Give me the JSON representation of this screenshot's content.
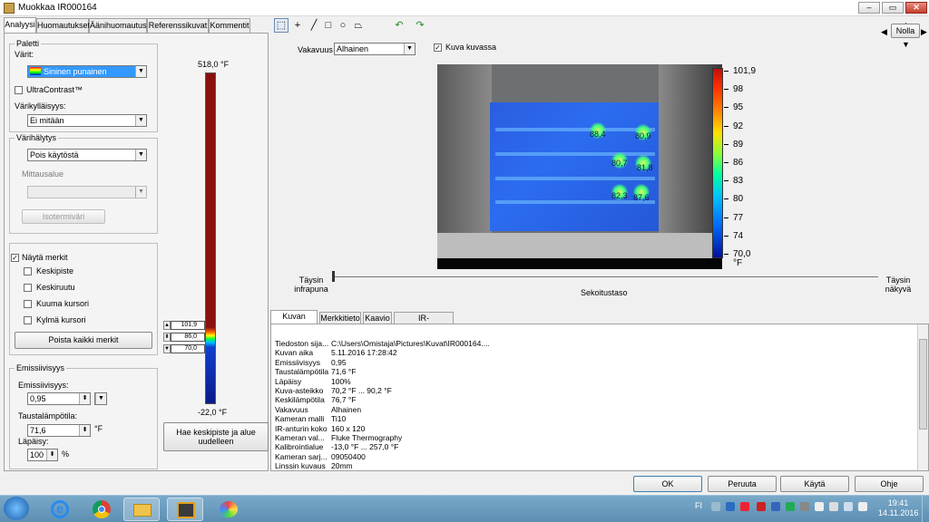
{
  "window": {
    "title": "Muokkaa IR000164",
    "min": "–",
    "max": "▭",
    "close": "✕"
  },
  "tabs": [
    "Analyysi",
    "Huomautukset",
    "Äänihuomautus",
    "Referenssikuvat",
    "Kommentit"
  ],
  "palette": {
    "group": "Paletti",
    "colors_label": "Värit:",
    "colors_value": "Sininen punainen",
    "ultracontrast": "UltraContrast™",
    "saturation_label": "Värikylläisyys:",
    "saturation_value": "Ei mitään"
  },
  "alarm": {
    "group": "Värihälytys",
    "value": "Pois käytöstä",
    "range_label": "Mittausalue",
    "isotherm": "Isotermiväri"
  },
  "markers": {
    "show": "Näytä merkit",
    "items": [
      "Keskipiste",
      "Keskiruutu",
      "Kuuma kursori",
      "Kylmä kursori"
    ],
    "remove_all": "Poista kaikki merkit"
  },
  "emissivity": {
    "group": "Emissiivisyys",
    "label": "Emissiivisyys:",
    "value": "0,95",
    "bg_label": "Taustalämpötila:",
    "bg_value": "71,6",
    "bg_unit": "°F",
    "trans_label": "Läpäisy:",
    "trans_value": "100",
    "trans_unit": "%"
  },
  "scale": {
    "top": "518,0 °F",
    "bottom": "-22,0 °F",
    "markers": [
      "101,9",
      "86,0",
      "70,0"
    ]
  },
  "reset_button": "Hae keskipiste ja alue uudelleen",
  "toolbar": {
    "icons": [
      "marquee-icon",
      "crosshair-icon",
      "line-icon",
      "square-icon",
      "circle-icon",
      "polygon-icon"
    ],
    "vakavuus_label": "Vakavuus",
    "vakavuus_value": "Alhainen",
    "kuva_kuvassa": "Kuva kuvassa",
    "nolla": "Nolla"
  },
  "image": {
    "scale_labels": [
      "101,9",
      "98",
      "95",
      "92",
      "89",
      "86",
      "83",
      "80",
      "77",
      "74",
      "70,0"
    ],
    "unit": "°F",
    "hotspots": [
      "88,4",
      "80,9",
      "80,7",
      "81,8",
      "82,3",
      "87,6"
    ]
  },
  "blend": {
    "left_top": "Täysin",
    "left_bottom": "infrapuna",
    "right_top": "Täysin",
    "right_bottom": "näkyvä",
    "center": "Sekoitustaso"
  },
  "bottom_tabs": [
    "Kuvan tiedot",
    "Merkkitieto",
    "Kaavio",
    "IR-PhotoNotes™"
  ],
  "info": [
    [
      "Tiedoston sija...",
      "C:\\Users\\Omistaja\\Pictures\\Kuvat\\IR000164...."
    ],
    [
      "Kuvan aika",
      "5.11.2016 17:28:42"
    ],
    [
      "Emissiivisyys",
      "0,95"
    ],
    [
      "Taustalämpötila",
      "71,6 °F"
    ],
    [
      "Läpäisy",
      "100%"
    ],
    [
      "Kuva-asteikko",
      "70,2 °F ... 90,2 °F"
    ],
    [
      "Keskilämpötila",
      "76,7 °F"
    ],
    [
      "Vakavuus",
      "Alhainen"
    ],
    [
      "Kameran malli",
      "Ti10"
    ],
    [
      "IR-anturin koko",
      "160 x 120"
    ],
    [
      "Kameran val...",
      "Fluke Thermography"
    ],
    [
      "Kalibrointialue",
      "-13,0 °F ... 257,0 °F"
    ],
    [
      "Kameran sarj...",
      "09050400"
    ],
    [
      "Linssin kuvaus",
      "20mm"
    ]
  ],
  "buttons": {
    "ok": "OK",
    "cancel": "Peruuta",
    "apply": "Käytä",
    "help": "Ohje"
  },
  "taskbar": {
    "lang": "FI",
    "time": "19:41",
    "date": "14.11.2016"
  }
}
